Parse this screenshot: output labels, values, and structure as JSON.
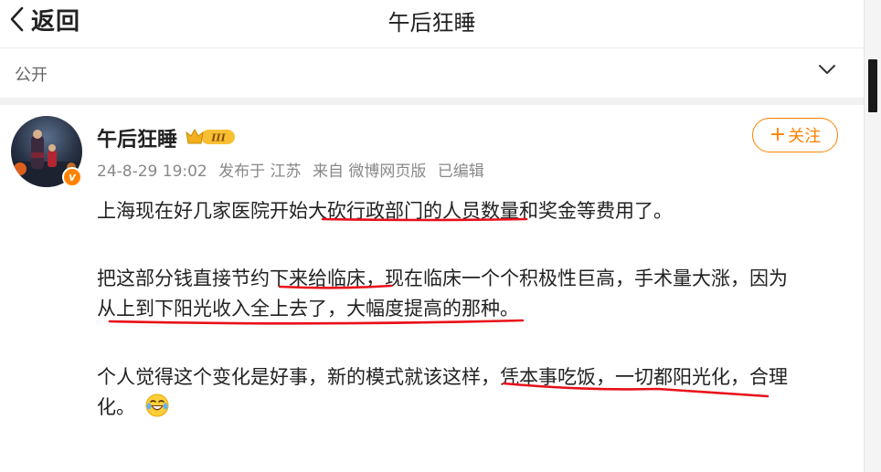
{
  "header": {
    "back_label": "返回",
    "title": "午后狂睡"
  },
  "visibility": {
    "label": "公开"
  },
  "post": {
    "author": "午后狂睡",
    "level_badge": "III",
    "verified_badge": "v",
    "follow_label": "关注",
    "meta": {
      "date": "24-8-29 19:02",
      "location": "发布于 江苏",
      "source": "来自 微博网页版",
      "edited": "已编辑"
    },
    "paragraphs": [
      "上海现在好几家医院开始大砍行政部门的人员数量和奖金等费用了。",
      "把这部分钱直接节约下来给临床，现在临床一个个积极性巨高，手术量大涨，因为",
      "从上到下阳光收入全上去了，大幅度提高的那种。",
      "个人觉得这个变化是好事，新的模式就该这样，凭本事吃饭，一切都阳光化，合理",
      "化。"
    ]
  },
  "colors": {
    "accent": "#ff8200",
    "underline": "#e8101a",
    "muted": "#888888"
  },
  "icons": {
    "back": "chevron-left-icon",
    "expand": "chevron-down-icon",
    "level": "crown-icon",
    "emoji": "laugh-cry-emoji-icon"
  }
}
